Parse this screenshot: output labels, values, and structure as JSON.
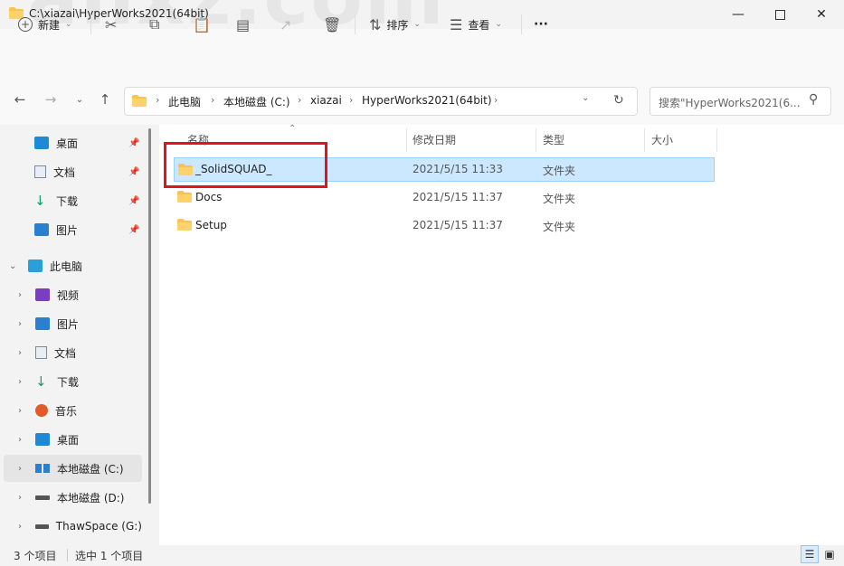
{
  "window": {
    "title": "C:\\xiazai\\HyperWorks2021(64bit)",
    "watermark": "anxz.com",
    "minimize_icon": "minimize-icon",
    "maximize_icon": "maximize-icon",
    "close_icon": "close-icon"
  },
  "toolbar": {
    "new_label": "新建",
    "sort_label": "排序",
    "view_label": "查看",
    "more_label": "···"
  },
  "address": {
    "crumbs": [
      "此电脑",
      "本地磁盘 (C:)",
      "xiazai",
      "HyperWorks2021(64bit)"
    ]
  },
  "search": {
    "placeholder": "搜索\"HyperWorks2021(6..."
  },
  "nav": {
    "quick_access": [
      {
        "label": "桌面",
        "icon": "desktop-icon"
      },
      {
        "label": "文档",
        "icon": "document-icon"
      },
      {
        "label": "下载",
        "icon": "download-icon"
      },
      {
        "label": "图片",
        "icon": "picture-icon"
      }
    ],
    "this_pc": "此电脑",
    "pc_items": [
      {
        "label": "视频",
        "icon": "video-icon"
      },
      {
        "label": "图片",
        "icon": "picture-icon"
      },
      {
        "label": "文档",
        "icon": "document-icon"
      },
      {
        "label": "下载",
        "icon": "download-icon"
      },
      {
        "label": "音乐",
        "icon": "music-icon"
      },
      {
        "label": "桌面",
        "icon": "desktop-icon"
      },
      {
        "label": "本地磁盘 (C:)",
        "icon": "windows-drive-icon"
      },
      {
        "label": "本地磁盘 (D:)",
        "icon": "drive-icon"
      },
      {
        "label": "ThawSpace (G:)",
        "icon": "drive-icon"
      }
    ]
  },
  "columns": {
    "name": "名称",
    "modified": "修改日期",
    "type": "类型",
    "size": "大小"
  },
  "files": [
    {
      "name": "_SolidSQUAD_",
      "modified": "2021/5/15 11:33",
      "type": "文件夹",
      "size": ""
    },
    {
      "name": "Docs",
      "modified": "2021/5/15 11:37",
      "type": "文件夹",
      "size": ""
    },
    {
      "name": "Setup",
      "modified": "2021/5/15 11:37",
      "type": "文件夹",
      "size": ""
    }
  ],
  "status": {
    "count": "3 个项目",
    "selected": "选中 1 个项目"
  },
  "colors": {
    "selection": "#cce8ff",
    "highlight_box": "#e0141e",
    "folder": "#f8c44f"
  }
}
